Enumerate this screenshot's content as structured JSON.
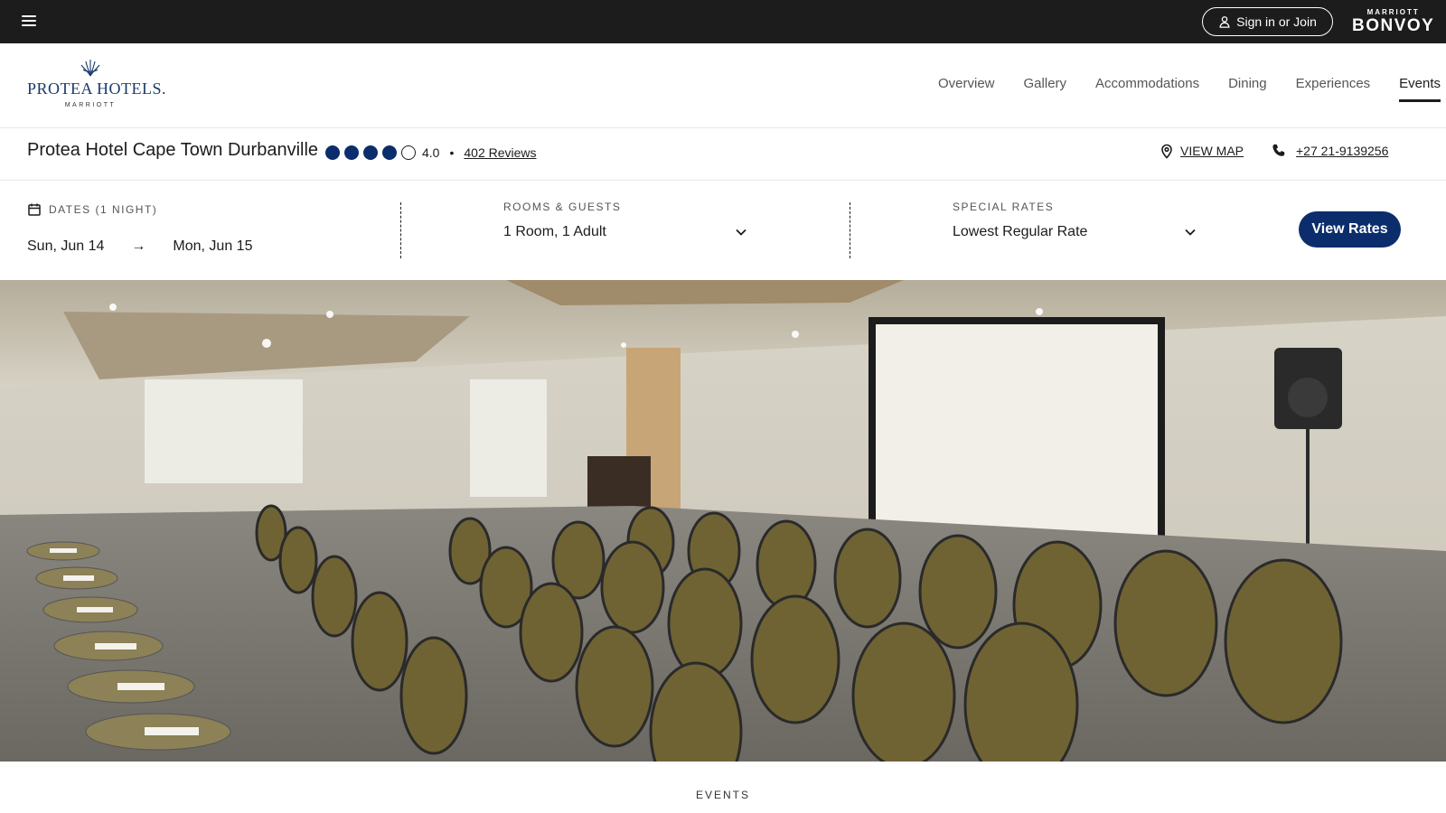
{
  "topbar": {
    "menu_icon": "hamburger-icon",
    "signin_label": "Sign in or Join",
    "signin_icon": "user-icon",
    "bonvoy_small": "MARRIOTT",
    "bonvoy_big": "BONVOY"
  },
  "brand": {
    "logo_name": "PROTEA HOTELS.",
    "logo_sub": "MARRIOTT",
    "nav": [
      "Overview",
      "Gallery",
      "Accommodations",
      "Dining",
      "Experiences",
      "Events"
    ],
    "active_nav": "Events"
  },
  "hotel": {
    "name": "Protea Hotel Cape Town Durbanville",
    "rating_value": 4,
    "rating_max": 5,
    "rating_text": "4.0",
    "separator": "•",
    "reviews": "402 Reviews",
    "view_map": "VIEW MAP",
    "map_icon": "map-pin-icon",
    "phone": "+27 21-9139256",
    "phone_icon": "phone-icon"
  },
  "booking": {
    "dates_label": "DATES (1 NIGHT)",
    "calendar_icon": "calendar-icon",
    "check_in": "Sun, Jun 14",
    "arrow": "→",
    "check_out": "Mon, Jun 15",
    "rooms_label": "ROOMS & GUESTS",
    "rooms_value": "1 Room, 1 Adult",
    "rates_label": "SPECIAL RATES",
    "rates_value": "Lowest Regular Rate",
    "view_rates": "View Rates"
  },
  "hero": {
    "image_icon": "conference-room-photo"
  },
  "section": {
    "label": "EVENTS"
  },
  "colors": {
    "topbar_bg": "#1c1c1c",
    "brand_navy": "#0b2d6b",
    "logo_blue": "#1a3a6b"
  }
}
